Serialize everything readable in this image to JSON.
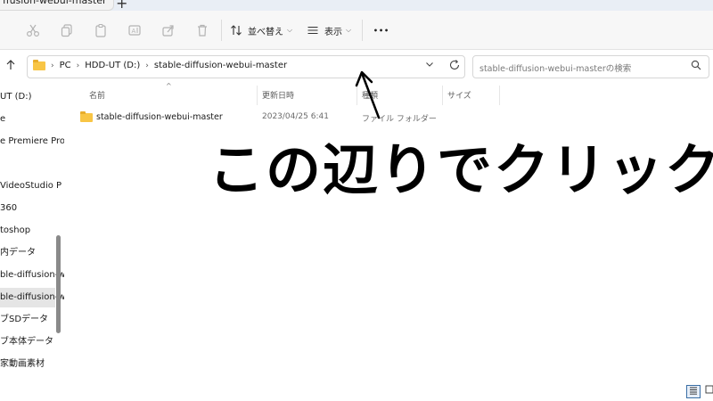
{
  "tab": {
    "title": "ffusion-webui-master",
    "new_tab": "+"
  },
  "toolbar": {
    "cut_icon": "scissors-icon",
    "copy_icon": "copy-icon",
    "paste_icon": "clipboard-icon",
    "rename_icon": "rename-icon",
    "share_icon": "share-icon",
    "delete_icon": "trash-icon",
    "sort_label": "並べ替え",
    "view_label": "表示",
    "more": "•••"
  },
  "address": {
    "crumbs": [
      "PC",
      "HDD-UT (D:)",
      "stable-diffusion-webui-master"
    ],
    "search_placeholder": "stable-diffusion-webui-masterの検索"
  },
  "nav": {
    "items": [
      {
        "label": "UT (D:)"
      },
      {
        "label": "e"
      },
      {
        "label": "e Premiere Pro"
      },
      {
        "label": ""
      },
      {
        "label": " VideoStudio P"
      },
      {
        "label": "360"
      },
      {
        "label": "toshop"
      },
      {
        "label": "内データ"
      },
      {
        "label": "ble-diffusion-web"
      },
      {
        "label": "ble-diffusion-web"
      },
      {
        "label": "ブSDデータ"
      },
      {
        "label": "ブ本体データ"
      },
      {
        "label": "家動画素材"
      }
    ],
    "selected_index": 9
  },
  "list": {
    "headers": {
      "name": "名前",
      "date": "更新日時",
      "type": "種類",
      "size": "サイズ"
    },
    "rows": [
      {
        "name": "stable-diffusion-webui-master",
        "date": "2023/04/25 6:41",
        "type": "ファイル フォルダー"
      }
    ]
  },
  "annotation": {
    "text": "この辺りでクリック"
  },
  "colors": {
    "folder": "#f8c545",
    "toolbar_bg": "#f7f7f7",
    "selected_nav": "#e5e5e5",
    "view_active": "#3a6ea5"
  }
}
